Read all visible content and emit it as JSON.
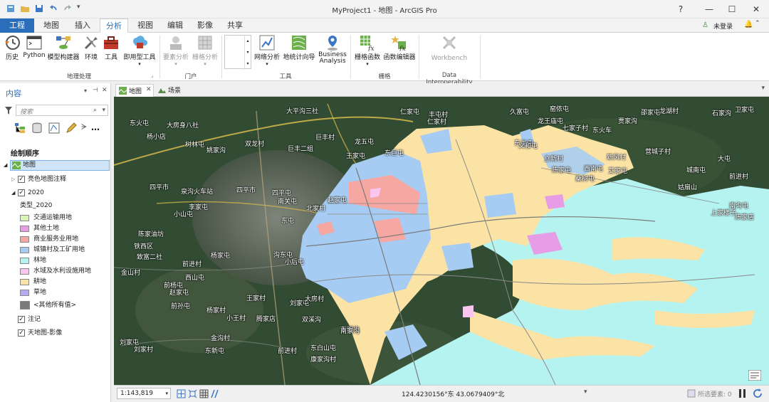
{
  "window": {
    "title": "MyProject1 - 地图 - ArcGIS Pro",
    "help": "?",
    "minimize": "—",
    "maximize": "☐",
    "close": "✕"
  },
  "tabs": [
    "工程",
    "地图",
    "插入",
    "分析",
    "视图",
    "编辑",
    "影像",
    "共享"
  ],
  "user": {
    "label": "未登录"
  },
  "ribbon": {
    "geoprocessing": {
      "group_label": "地理处理",
      "buttons": [
        "历史",
        "Python",
        "模型构建器",
        "环境",
        "工具",
        "即用型工具"
      ]
    },
    "portal": {
      "group_label": "门户",
      "buttons": [
        "要素分析",
        "栅格分析"
      ]
    },
    "tools": {
      "group_label": "工具",
      "buttons": [
        "网络分析",
        "地统计向导",
        "Business\nAnalysis"
      ]
    },
    "raster": {
      "group_label": "栅格",
      "buttons": [
        "栅格函数",
        "函数编辑器"
      ]
    },
    "interop": {
      "group_label": "Data Interoperability",
      "buttons": [
        "Workbench"
      ]
    }
  },
  "contents": {
    "title": "内容",
    "search_placeholder": "搜索",
    "drawing_order": "绘制顺序",
    "map": "地图",
    "annotation": "亮色地图注释",
    "layer": "2020",
    "field": "类型_2020",
    "legend": [
      {
        "label": "交通运输用地",
        "color": "#d6f5b6"
      },
      {
        "label": "其他土地",
        "color": "#e79ce6"
      },
      {
        "label": "商业服务业用地",
        "color": "#f6a7a2"
      },
      {
        "label": "城镇村及工矿用地",
        "color": "#a6ccf3"
      },
      {
        "label": "林地",
        "color": "#b5f3f0"
      },
      {
        "label": "水域及水利设施用地",
        "color": "#f9c6f0"
      },
      {
        "label": "耕地",
        "color": "#fbe3a6"
      },
      {
        "label": "草地",
        "color": "#b8aaf2"
      }
    ],
    "other": "<其他所有值>",
    "other_color": "#7a7a7a",
    "notes_layer": "注记",
    "imagery_layer": "天地图-影像"
  },
  "view_tabs": {
    "map": "地图",
    "scene": "场景"
  },
  "map_labels": [
    "大平沟三社",
    "仁家屯",
    "久富屯",
    "窑侬屯",
    "龙湖村",
    "石家沟",
    "卫家屯",
    "丰屯村",
    "仁家村",
    "龙王庙屯",
    "贾家沟",
    "邵家屯",
    "七家子村",
    "东火车",
    "东火屯",
    "大房身八社",
    "巨丰村",
    "龙五屯",
    "东龙屯",
    "义和屯",
    "杨小店",
    "树林屯",
    "姚家沟",
    "双龙村",
    "巨丰二组",
    "王家屯",
    "东巨屯",
    "新风村",
    "营城子村",
    "立新村",
    "陈家屯",
    "艾家屯",
    "城南屯",
    "大屯",
    "前进村",
    "桑树屯",
    "西南屯",
    "姑扇山",
    "泉沟火车站",
    "四平市",
    "四平市",
    "四平屯",
    "南关屯",
    "赵家屯",
    "北家村",
    "李家屯",
    "小山屯",
    "南沟屯",
    "陈家店",
    "上家楼子",
    "陈家油坊",
    "铁西区",
    "致富二社",
    "东屯",
    "沟东屯",
    "小后屯",
    "杨家屯",
    "前进村",
    "金山村",
    "前杨屯",
    "西山屯",
    "赵家屯",
    "杨家村",
    "王家村",
    "刘家屯",
    "大房村",
    "前孙屯",
    "腾家店",
    "双溪沟",
    "小王村",
    "东明屯",
    "金沟村",
    "刘家屯",
    "刘家村",
    "东白山屯",
    "前进村",
    "康家沟村",
    "南家沟",
    "东新屯"
  ],
  "status": {
    "scale": "1:143,819",
    "coords": "124.4230156°东 43.0679409°北",
    "selected": "所选要素: 0"
  }
}
